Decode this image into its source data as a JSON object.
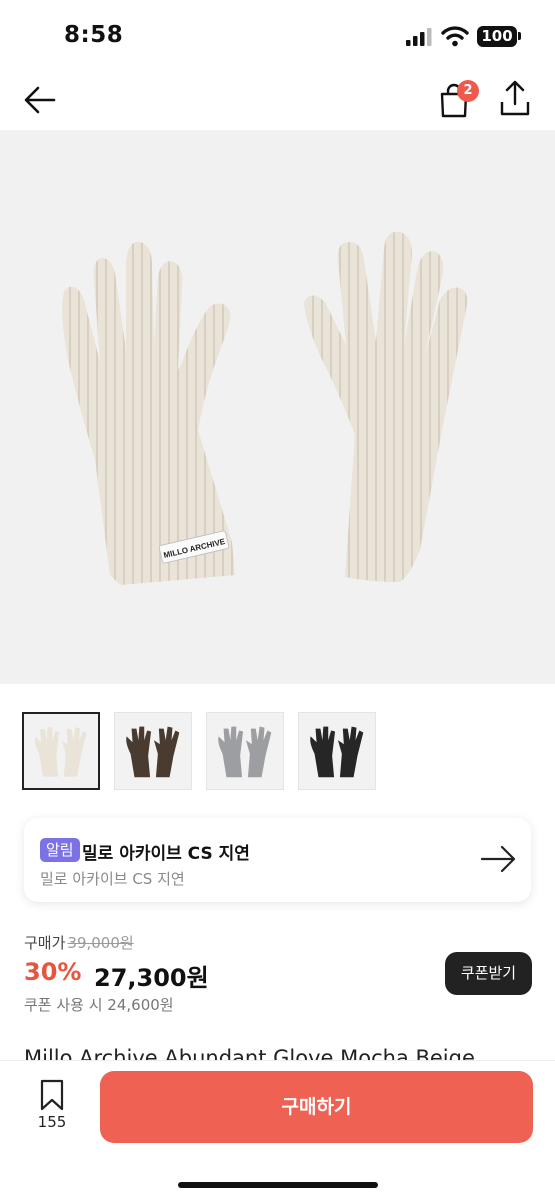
{
  "status_bar": {
    "time": "8:58",
    "battery": "100"
  },
  "nav": {
    "cart_count": "2"
  },
  "hero": {
    "label_text": "MILLO ARCHIVE",
    "glove_color": "#e9e3d8"
  },
  "thumbnails": [
    {
      "color": "#e9e3d8",
      "selected": true
    },
    {
      "color": "#4a3b30",
      "selected": false
    },
    {
      "color": "#9c9ea2",
      "selected": false
    },
    {
      "color": "#262626",
      "selected": false
    }
  ],
  "notice": {
    "badge": "알림",
    "title": "밀로 아카이브 CS 지연",
    "subtitle": "밀로 아카이브 CS 지연"
  },
  "price": {
    "label": "구매가",
    "original": "39,000원",
    "discount": "30%",
    "final": "27,300원",
    "coupon_price": "쿠폰 사용 시 24,600원",
    "coupon_button": "쿠폰받기"
  },
  "product": {
    "name": "Millo Archive Abundant Glove Mocha Beige"
  },
  "bottom": {
    "bookmark_count": "155",
    "buy_button": "구매하기"
  },
  "colors": {
    "accent": "#ef6152",
    "discount": "#e8553f",
    "badge": "#7b72e6"
  }
}
